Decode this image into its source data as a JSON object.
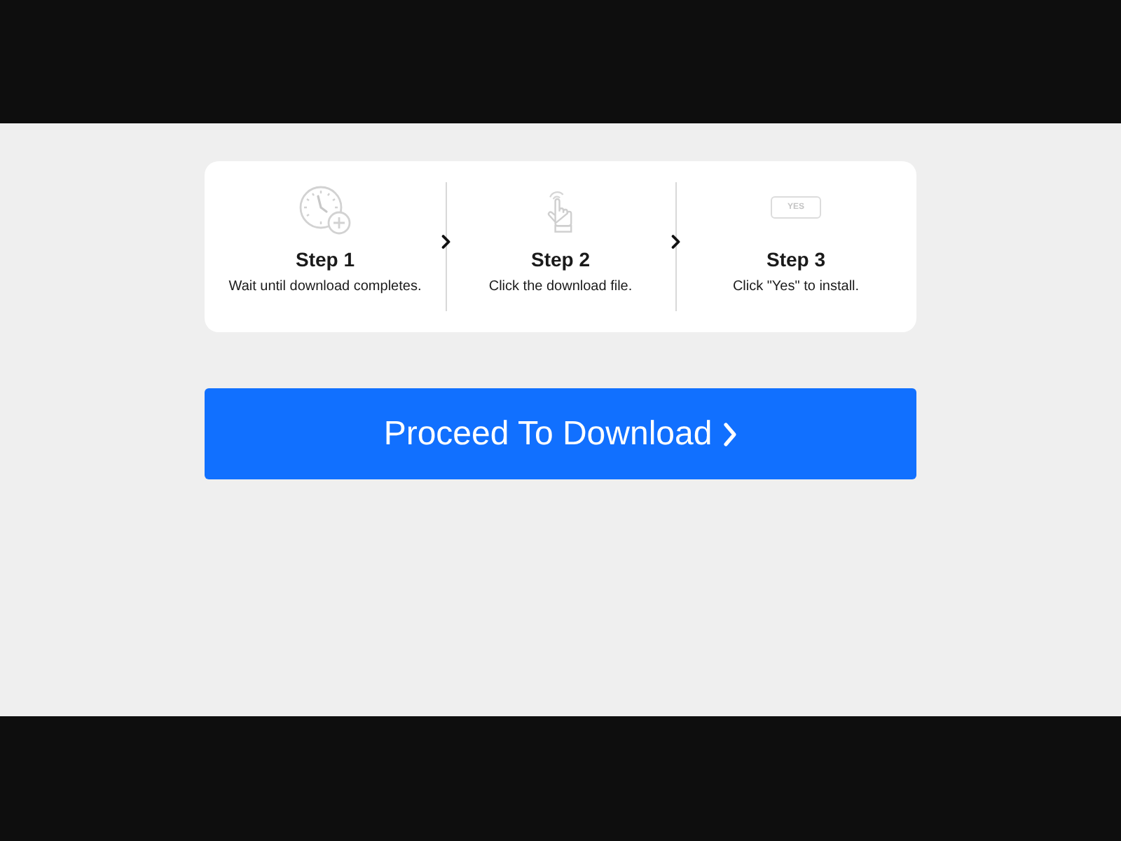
{
  "steps": [
    {
      "kind": "clock",
      "title": "Step 1",
      "description": "Wait until download completes."
    },
    {
      "kind": "tap",
      "title": "Step 2",
      "description": "Click the download file."
    },
    {
      "kind": "button",
      "icon_text": "YES",
      "title": "Step 3",
      "description": "Click \"Yes\" to install."
    }
  ],
  "proceed_button": {
    "label": "Proceed To Download"
  }
}
